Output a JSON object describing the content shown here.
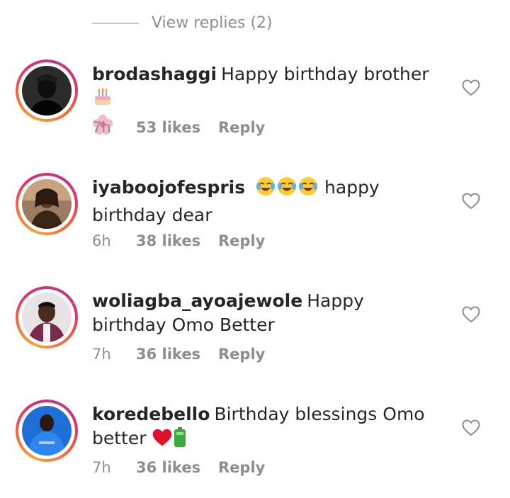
{
  "view_replies": {
    "label": "View replies (2)"
  },
  "comments": [
    {
      "username": "brodashaggi",
      "text": "Happy birthday brother",
      "time": "7h",
      "likes": "53 likes",
      "reply": "Reply",
      "emojis": [
        "birthday-cake-emoji",
        "cherry-blossom-emoji"
      ]
    },
    {
      "username": "iyaboojofespris",
      "text": "happy birthday dear",
      "time": "6h",
      "likes": "38 likes",
      "reply": "Reply",
      "emojis": [
        "tears-of-joy-emoji",
        "tears-of-joy-emoji",
        "tears-of-joy-emoji"
      ]
    },
    {
      "username": "woliagba_ayoajewole",
      "text": "Happy birthday Omo Better",
      "time": "7h",
      "likes": "36 likes",
      "reply": "Reply",
      "emojis": []
    },
    {
      "username": "koredebello",
      "text": "Birthday blessings Omo better",
      "time": "7h",
      "likes": "36 likes",
      "reply": "Reply",
      "emojis": [
        "red-heart-emoji",
        "battery-emoji"
      ]
    }
  ],
  "colors": {
    "text": "#262626",
    "secondary": "#8e8e8e",
    "ring_start": "#f9a13b",
    "ring_end": "#c13584"
  }
}
